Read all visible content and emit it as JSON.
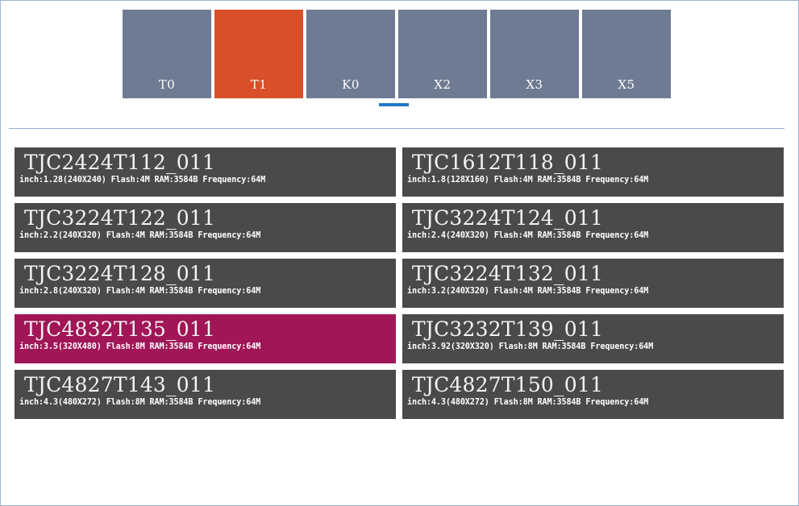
{
  "tabs": [
    {
      "label": "T0",
      "active": false
    },
    {
      "label": "T1",
      "active": true
    },
    {
      "label": "K0",
      "active": false
    },
    {
      "label": "X2",
      "active": false
    },
    {
      "label": "X3",
      "active": false
    },
    {
      "label": "X5",
      "active": false
    }
  ],
  "colors": {
    "tab": "#6e7b93",
    "tab_active": "#d84f2a",
    "card": "#4a4a4a",
    "card_active": "#a01656",
    "indicator": "#1f79c9"
  },
  "devices": [
    {
      "model": "TJC2424T112_011",
      "spec": "inch:1.28(240X240) Flash:4M RAM:3584B Frequency:64M",
      "selected": false
    },
    {
      "model": "TJC1612T118_011",
      "spec": "inch:1.8(128X160) Flash:4M RAM:3584B Frequency:64M",
      "selected": false
    },
    {
      "model": "TJC3224T122_011",
      "spec": "inch:2.2(240X320) Flash:4M RAM:3584B Frequency:64M",
      "selected": false
    },
    {
      "model": "TJC3224T124_011",
      "spec": "inch:2.4(240X320) Flash:4M RAM:3584B Frequency:64M",
      "selected": false
    },
    {
      "model": "TJC3224T128_011",
      "spec": "inch:2.8(240X320) Flash:4M RAM:3584B Frequency:64M",
      "selected": false
    },
    {
      "model": "TJC3224T132_011",
      "spec": "inch:3.2(240X320) Flash:4M RAM:3584B Frequency:64M",
      "selected": false
    },
    {
      "model": "TJC4832T135_011",
      "spec": "inch:3.5(320X480) Flash:8M RAM:3584B Frequency:64M",
      "selected": true
    },
    {
      "model": "TJC3232T139_011",
      "spec": "inch:3.92(320X320) Flash:8M RAM:3584B Frequency:64M",
      "selected": false
    },
    {
      "model": "TJC4827T143_011",
      "spec": "inch:4.3(480X272) Flash:8M RAM:3584B Frequency:64M",
      "selected": false
    },
    {
      "model": "TJC4827T150_011",
      "spec": "inch:4.3(480X272) Flash:8M RAM:3584B Frequency:64M",
      "selected": false
    }
  ]
}
